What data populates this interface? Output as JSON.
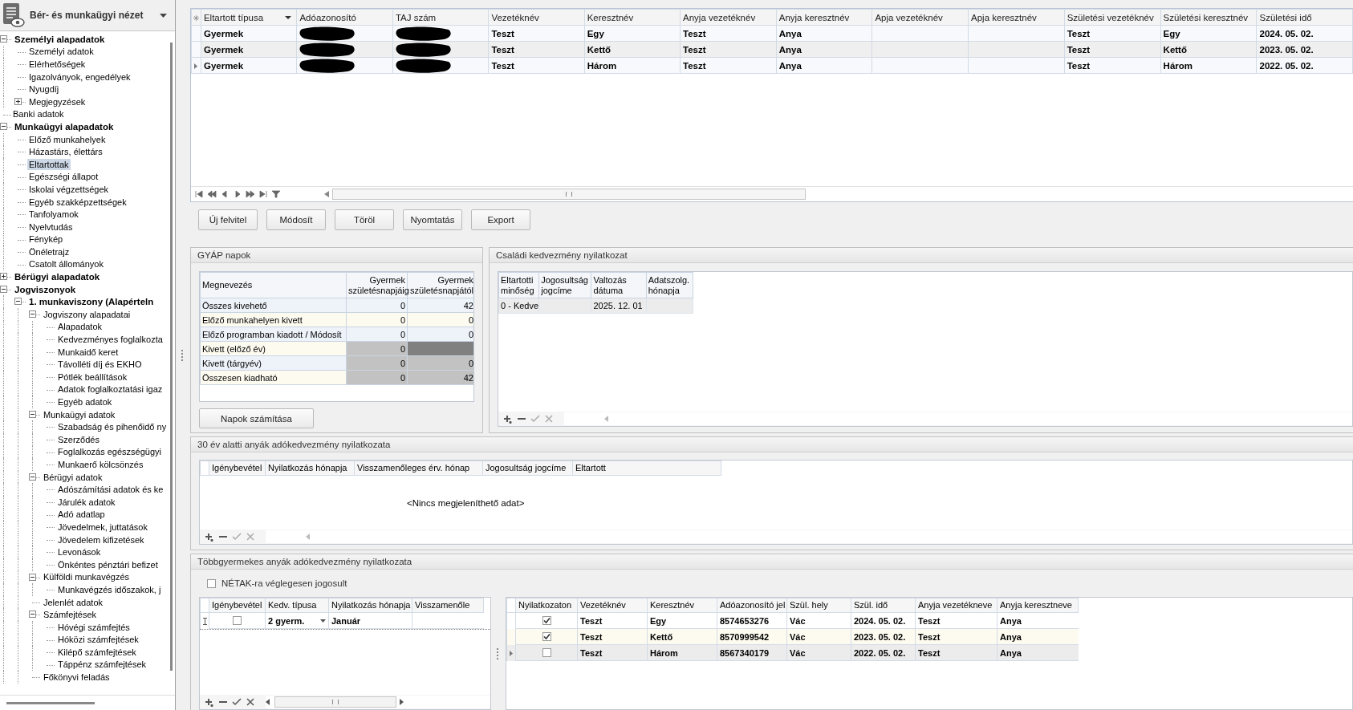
{
  "sidebar": {
    "title": "Bér- és munkaügyi nézet",
    "tree": [
      {
        "label": "Személyi alapadatok",
        "bold": true,
        "expanded": true,
        "selected": false,
        "children": [
          {
            "label": "Személyi adatok",
            "selected": false
          },
          {
            "label": "Elérhetőségek",
            "selected": false
          },
          {
            "label": "Igazolványok, engedélyek",
            "selected": false
          },
          {
            "label": "Nyugdíj",
            "selected": false
          },
          {
            "label": "Megjegyzések",
            "expanded": false,
            "selected": false
          }
        ]
      },
      {
        "label": "Banki adatok",
        "selected": false
      },
      {
        "label": "Munkaügyi alapadatok",
        "bold": true,
        "expanded": true,
        "selected": false,
        "children": [
          {
            "label": "Előző munkahelyek",
            "selected": false
          },
          {
            "label": "Házastárs, élettárs",
            "selected": false
          },
          {
            "label": "Eltartottak",
            "selected": true
          },
          {
            "label": "Egészségi állapot",
            "selected": false
          },
          {
            "label": "Iskolai végzettségek",
            "selected": false
          },
          {
            "label": "Egyéb szakképzettségek",
            "selected": false
          },
          {
            "label": "Tanfolyamok",
            "selected": false
          },
          {
            "label": "Nyelvtudás",
            "selected": false
          },
          {
            "label": "Fénykép",
            "selected": false
          },
          {
            "label": "Önéletrajz",
            "selected": false
          },
          {
            "label": "Csatolt állományok",
            "selected": false
          }
        ]
      },
      {
        "label": "Bérügyi alapadatok",
        "bold": true,
        "expanded": false,
        "selected": false
      },
      {
        "label": "Jogviszonyok",
        "bold": true,
        "expanded": true,
        "selected": false,
        "children": [
          {
            "label": "1. munkaviszony  (Alapérteln",
            "bold": true,
            "expanded": true,
            "selected": false,
            "children": [
              {
                "label": "Jogviszony alapadatai",
                "expanded": true,
                "selected": false,
                "children": [
                  {
                    "label": "Alapadatok",
                    "selected": false
                  },
                  {
                    "label": "Kedvezményes foglalkozta",
                    "selected": false
                  },
                  {
                    "label": "Munkaidő keret",
                    "selected": false
                  },
                  {
                    "label": "Távolléti díj és EKHO",
                    "selected": false
                  },
                  {
                    "label": "Pótlék beállítások",
                    "selected": false
                  },
                  {
                    "label": "Adatok foglalkoztatási igaz",
                    "selected": false
                  },
                  {
                    "label": "Egyéb adatok",
                    "selected": false
                  }
                ]
              },
              {
                "label": "Munkaügyi adatok",
                "expanded": true,
                "selected": false,
                "children": [
                  {
                    "label": "Szabadság és pihenőidő ny",
                    "selected": false
                  },
                  {
                    "label": "Szerződés",
                    "selected": false
                  },
                  {
                    "label": "Foglalkozás egészségügyi",
                    "selected": false
                  },
                  {
                    "label": "Munkaerő kölcsönzés",
                    "selected": false
                  }
                ]
              },
              {
                "label": "Bérügyi adatok",
                "expanded": true,
                "selected": false,
                "children": [
                  {
                    "label": "Adószámítási adatok és ke",
                    "selected": false
                  },
                  {
                    "label": "Járulék adatok",
                    "selected": false
                  },
                  {
                    "label": "Adó adatlap",
                    "selected": false
                  },
                  {
                    "label": "Jövedelmek, juttatások",
                    "selected": false
                  },
                  {
                    "label": "Jövedelem kifizetések",
                    "selected": false
                  },
                  {
                    "label": "Levonások",
                    "selected": false
                  },
                  {
                    "label": "Önkéntes pénztári befizet",
                    "selected": false
                  }
                ]
              },
              {
                "label": "Külföldi munkavégzés",
                "expanded": true,
                "selected": false,
                "children": [
                  {
                    "label": "Munkavégzés időszakok, j",
                    "selected": false
                  }
                ]
              },
              {
                "label": "Jelenlét adatok",
                "selected": false
              },
              {
                "label": "Számfejtések",
                "expanded": true,
                "selected": false,
                "children": [
                  {
                    "label": "Hóvégi számfejtés",
                    "selected": false
                  },
                  {
                    "label": "Hóközi számfejtések",
                    "selected": false
                  },
                  {
                    "label": "Kilépő számfejtések",
                    "selected": false
                  },
                  {
                    "label": "Táppénz számfejtések",
                    "selected": false
                  }
                ]
              },
              {
                "label": "Főkönyvi feladás",
                "selected": false
              }
            ]
          }
        ]
      }
    ]
  },
  "dependents_table": {
    "columns": [
      "Eltartott típusa",
      "Adóazonosító",
      "TAJ szám",
      "Vezetéknév",
      "Keresztnév",
      "Anyja vezetéknév",
      "Anyja keresztnév",
      "Apja vezetéknév",
      "Apja keresztnév",
      "Születési vezetéknév",
      "Születési keresztnév",
      "Születési idő"
    ],
    "rows": [
      {
        "selected": false,
        "cells": [
          "Gyermek",
          {
            "redacted": true
          },
          {
            "redacted": true
          },
          "Teszt",
          "Egy",
          "Teszt",
          "Anya",
          "",
          "",
          "Teszt",
          "Egy",
          "2024. 05. 02."
        ]
      },
      {
        "selected": false,
        "cells": [
          "Gyermek",
          {
            "redacted": true
          },
          {
            "redacted": true
          },
          "Teszt",
          "Kettő",
          "Teszt",
          "Anya",
          "",
          "",
          "Teszt",
          "Kettő",
          "2023. 05. 02."
        ]
      },
      {
        "selected": true,
        "cells": [
          "Gyermek",
          {
            "redacted": true
          },
          {
            "redacted": true
          },
          "Teszt",
          "Három",
          "Teszt",
          "Anya",
          "",
          "",
          "Teszt",
          "Három",
          "2022. 05. 02."
        ]
      }
    ]
  },
  "buttons": [
    "Új felvitel",
    "Módosít",
    "Töröl",
    "Nyomtatás",
    "Export"
  ],
  "gyap_panel": {
    "title": "GYÁP napok",
    "columns": [
      "Megnevezés",
      "Gyermek születésnapjáig",
      "Gyermek születésnapjától"
    ],
    "rows": [
      {
        "label": "Összes kivehető",
        "readonly": false,
        "values": [
          "0",
          "42"
        ]
      },
      {
        "label": "Előző munkahelyen kivett",
        "readonly": false,
        "values": [
          "0",
          "0"
        ]
      },
      {
        "label": "Előző programban kiadott / Módosít",
        "readonly": false,
        "values": [
          "0",
          "0"
        ]
      },
      {
        "label": "Kivett (előző év)",
        "readonly": true,
        "blocked": true,
        "values": [
          "0"
        ]
      },
      {
        "label": "Kivett (tárgyév)",
        "readonly": true,
        "values": [
          "0",
          "0"
        ]
      },
      {
        "label": "Összesen kiadható",
        "readonly": true,
        "values": [
          "0",
          "42"
        ]
      }
    ],
    "button": "Napok számítása"
  },
  "family_panel": {
    "title": "Családi kedvezmény nyilatkozat",
    "columns": [
      "Eltartotti minőség",
      "Jogosultság jogcíme",
      "Valtozás dátuma",
      "Adatszolg. hónapja"
    ],
    "rows": [
      [
        "0 - Kedve",
        "",
        "2025. 12. 01",
        ""
      ]
    ]
  },
  "under30_panel": {
    "title": "30 év alatti anyák adókedvezmény nyilatkozata",
    "columns": [
      "Igénybevétel",
      "Nyilatkozás hónapja",
      "Visszamenőleges érv. hónap",
      "Jogosultság jogcíme",
      "Eltartott"
    ],
    "empty_text": "<Nincs megjeleníthető adat>"
  },
  "multichild_panel": {
    "title": "Többgyermekes anyák adókedvezmény nyilatkozata",
    "checkbox": {
      "label": "NÉTAK-ra véglegesen jogosult",
      "checked": false
    },
    "left_table": {
      "columns": [
        "Igénybevétel",
        "Kedv. típusa",
        "Nyilatkozás hónapja",
        "Visszamenőle"
      ],
      "rows": [
        {
          "claimed": false,
          "cells": [
            "",
            "2 gyerm.",
            "Január",
            ""
          ]
        }
      ]
    },
    "right_table": {
      "columns": [
        "Nyilatkozaton",
        "Vezetéknév",
        "Keresztnév",
        "Adóazonosító jel",
        "Szül. hely",
        "Szül. idő",
        "Anyja vezetékneve",
        "Anyja keresztneve"
      ],
      "rows": [
        {
          "checked": true,
          "selected": false,
          "cells": [
            "",
            "Teszt",
            "Egy",
            "8574653276",
            "Vác",
            "2024. 05. 02.",
            "Teszt",
            "Anya"
          ]
        },
        {
          "checked": true,
          "selected": false,
          "cells": [
            "",
            "Teszt",
            "Kettő",
            "8570999542",
            "Vác",
            "2023. 05. 02.",
            "Teszt",
            "Anya"
          ]
        },
        {
          "checked": false,
          "selected": true,
          "cells": [
            "",
            "Teszt",
            "Három",
            "8567340179",
            "Vác",
            "2022. 05. 02.",
            "Teszt",
            "Anya"
          ]
        }
      ]
    }
  }
}
